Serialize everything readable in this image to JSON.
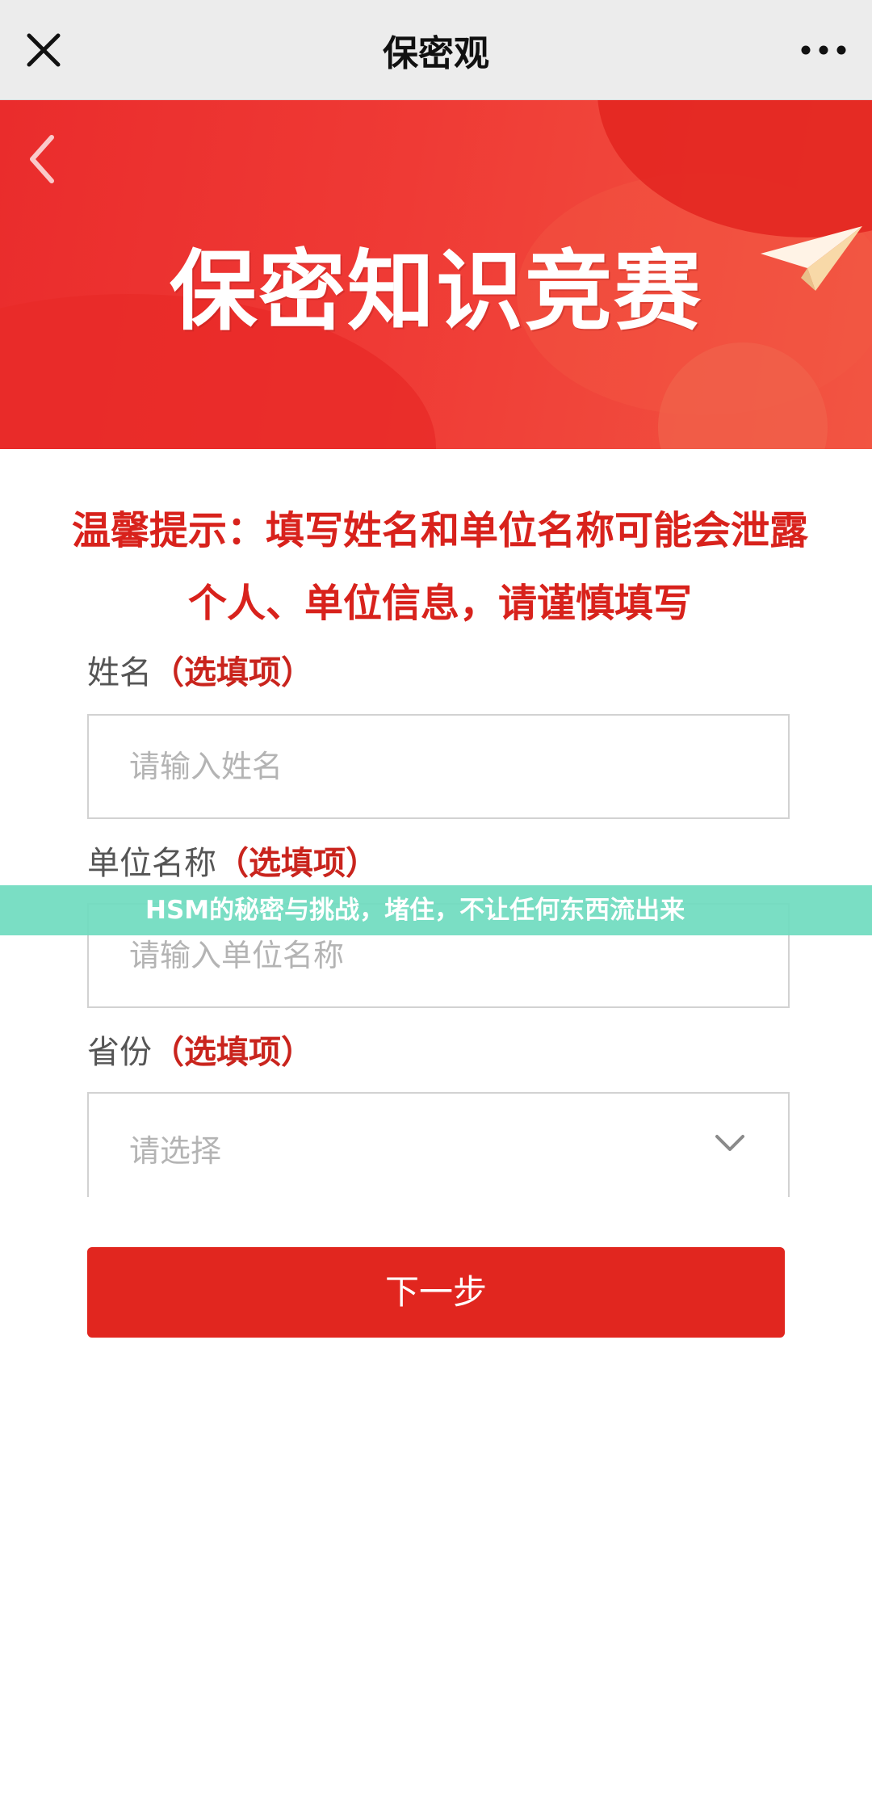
{
  "topbar": {
    "title": "保密观",
    "close_icon": "close-icon",
    "more_icon": "more-dots-icon"
  },
  "banner": {
    "heading": "保密知识竞赛",
    "back_icon": "chevron-left-icon",
    "decoration_icon": "paper-plane-icon"
  },
  "notice": {
    "text": "温馨提示：填写姓名和单位名称可能会泄露个人、单位信息，请谨慎填写"
  },
  "form": {
    "name_label": "姓名",
    "name_optional": "（选填项）",
    "name_placeholder": "请输入姓名",
    "org_label": "单位名称",
    "org_optional": "（选填项）",
    "org_placeholder": "请输入单位名称",
    "province_label": "省份",
    "province_optional": "（选填项）",
    "province_placeholder": "请选择",
    "next_button": "下一步"
  },
  "caption": {
    "text": "HSM的秘密与挑战，堵住，不让任何东西流出来"
  },
  "colors": {
    "brand_red": "#e1261f",
    "notice_red": "#d8221c",
    "caption_teal": "#70dcc0"
  }
}
